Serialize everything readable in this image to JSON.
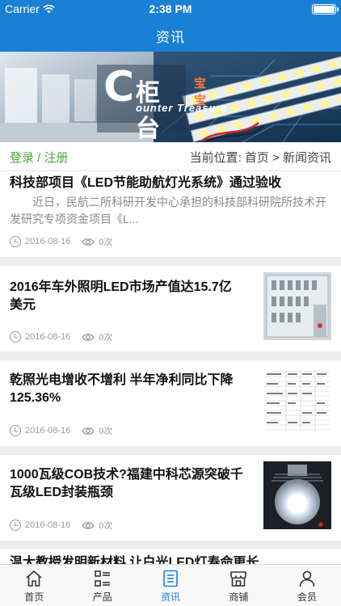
{
  "status": {
    "carrier": "Carrier",
    "time": "2:38 PM"
  },
  "nav": {
    "title": "资讯"
  },
  "banner": {
    "logo_letter": "C",
    "logo_zh": "柜台",
    "logo_zh_small": "宝宝",
    "logo_en": "ounter Treasure"
  },
  "breadcrumb": {
    "login": "登录 / 注册",
    "location": "当前位置:  首页 > 新闻资讯"
  },
  "articles": [
    {
      "title": "科技部项目《LED节能助航灯光系统》通过验收",
      "summary": "近日，民航二所科研开发中心承担的科技部科研院所技术开发研究专项资金项目《L...",
      "date": "2016-08-16",
      "views": "0次"
    },
    {
      "title": "2016年车外照明LED市场产值达15.7亿美元",
      "date": "2016-08-16",
      "views": "0次"
    },
    {
      "title": "乾照光电增收不增利 半年净利同比下降125.36%",
      "date": "2016-08-16",
      "views": "0次"
    },
    {
      "title": "1000瓦级COB技术?福建中科芯源突破千瓦级LED封装瓶颈",
      "date": "2016-08-16",
      "views": "0次"
    },
    {
      "title": "温大教授发明新材料 让白光LED灯寿命更长"
    }
  ],
  "tabs": [
    {
      "label": "首页",
      "icon": "home-icon"
    },
    {
      "label": "产品",
      "icon": "list-icon"
    },
    {
      "label": "资讯",
      "icon": "news-icon"
    },
    {
      "label": "商铺",
      "icon": "shop-icon"
    },
    {
      "label": "会员",
      "icon": "user-icon"
    }
  ],
  "colors": {
    "brand": "#1a80d6",
    "login": "#4aa83a"
  }
}
